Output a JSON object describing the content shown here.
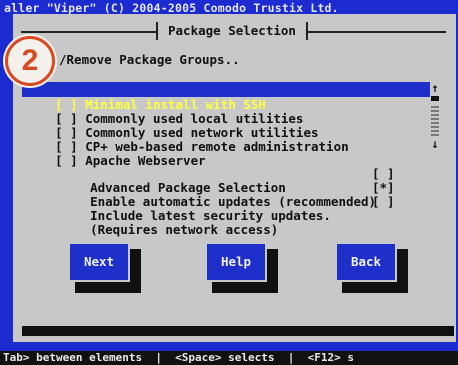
{
  "header": {
    "text": "aller \"Viper\" (C) 2004-2005 Comodo Trustix Ltd."
  },
  "window": {
    "title": "Package Selection"
  },
  "section": {
    "title": "/Remove Package Groups.."
  },
  "package_groups": [
    {
      "checkbox": "[ ]",
      "label": "Minimal install with SSH",
      "selected": true
    },
    {
      "checkbox": "[ ]",
      "label": "Commonly used local utilities",
      "selected": false
    },
    {
      "checkbox": "[ ]",
      "label": "Commonly used network utilities",
      "selected": false
    },
    {
      "checkbox": "[ ]",
      "label": "CP+ web-based remote administration",
      "selected": false
    },
    {
      "checkbox": "[ ]",
      "label": "Apache Webserver",
      "selected": false
    }
  ],
  "scrollbar": {
    "up_icon": "up-arrow",
    "down_icon": "down-arrow",
    "up_glyph": "↑",
    "down_glyph": "↓"
  },
  "options": [
    {
      "label": "Advanced Package Selection",
      "value": "[ ]"
    },
    {
      "label": "Enable automatic updates (recommended)",
      "value": "[*]"
    },
    {
      "label": "Include latest security updates.",
      "value": "[ ]"
    },
    {
      "label": "(Requires network access)",
      "value": ""
    }
  ],
  "buttons": {
    "next": "Next",
    "help": "Help",
    "back": "Back"
  },
  "status": {
    "text": "Tab> between elements  |  <Space> selects  |  <F12> s"
  },
  "badge": {
    "number": "2"
  },
  "colors": {
    "accent": "#1e30c9",
    "highlight_text": "#ffff40",
    "dialog_bg": "#c8c8c8",
    "badge": "#d84a1f"
  }
}
